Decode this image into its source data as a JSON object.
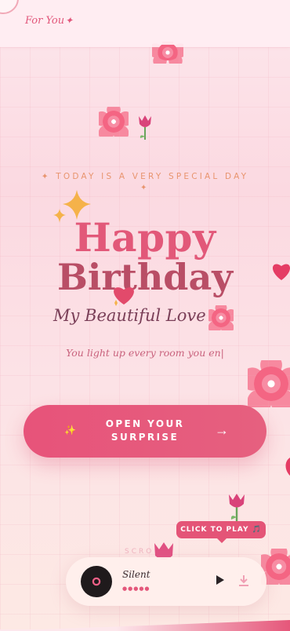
{
  "header": {
    "brand": "For You",
    "brand_star": "✦"
  },
  "hero": {
    "tagline": "✦ TODAY IS A VERY SPECIAL DAY",
    "tagline_star": "✦",
    "title_line1": "Happy",
    "title_line2": "Birthday",
    "subtitle": "My Beautiful Love",
    "typed_text": "You light up every room you en|"
  },
  "cta": {
    "sparkle": "✨",
    "label_line1": "OPEN YOUR",
    "label_line2": "SURPRISE",
    "arrow": "→"
  },
  "music": {
    "tooltip": "CLICK TO PLAY 🎵",
    "scroll_hint": "SCRO",
    "track_name": "Silent",
    "track_dots": "●●●●●"
  },
  "colors": {
    "accent": "#e25879",
    "accent_dark": "#b94e66",
    "button": "#e7537a",
    "tagline": "#e8956f",
    "background": "#fde7ec"
  },
  "icons": [
    "cherry-blossom-icon",
    "tulip-icon",
    "heart-icon",
    "sparkle-icon",
    "vinyl-disc-icon",
    "play-icon",
    "download-icon"
  ]
}
